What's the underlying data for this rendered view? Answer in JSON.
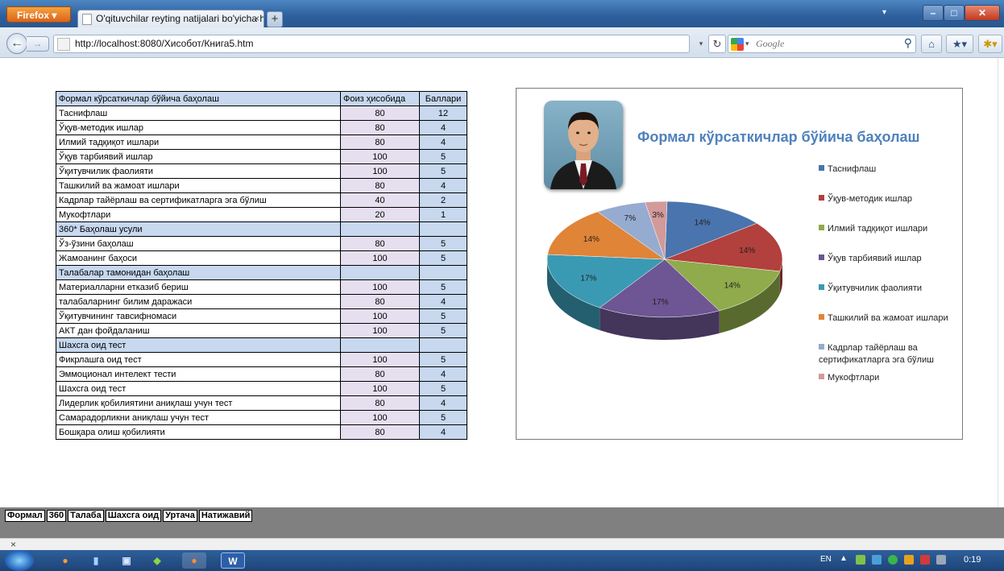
{
  "browser": {
    "menu_button": "Firefox",
    "tab_title": "O'qituvchilar reyting natijalari bo'yicha h...",
    "url": "http://localhost:8080/Хисобот/Книга5.htm",
    "search_placeholder": "Google"
  },
  "table": {
    "header": {
      "criterion": "Формал кўрсаткичлар бўйича баҳолаш",
      "percent": "Фоиз ҳисобида",
      "points": "Баллари"
    },
    "rows": [
      {
        "name": "Таснифлаш",
        "percent": "80",
        "points": "12",
        "section": false
      },
      {
        "name": "Ўқув-методик ишлар",
        "percent": "80",
        "points": "4",
        "section": false
      },
      {
        "name": "Илмий тадқиқот ишлари",
        "percent": "80",
        "points": "4",
        "section": false
      },
      {
        "name": "Ўқув тарбиявий ишлар",
        "percent": "100",
        "points": "5",
        "section": false
      },
      {
        "name": "Ўқитувчилик фаолияти",
        "percent": "100",
        "points": "5",
        "section": false
      },
      {
        "name": "Ташкилий ва жамоат ишлари",
        "percent": "80",
        "points": "4",
        "section": false
      },
      {
        "name": "Кадрлар тайёрлаш ва сертификатларга эга бўлиш",
        "percent": "40",
        "points": "2",
        "section": false
      },
      {
        "name": "Мукофтлари",
        "percent": "20",
        "points": "1",
        "section": false
      },
      {
        "name": "360* Баҳолаш усули",
        "percent": "",
        "points": "",
        "section": true
      },
      {
        "name": "Ўз-ўзини баҳолаш",
        "percent": "80",
        "points": "5",
        "section": false
      },
      {
        "name": "Жамоанинг баҳоси",
        "percent": "100",
        "points": "5",
        "section": false
      },
      {
        "name": "Талабалар тамонидан баҳолаш",
        "percent": "",
        "points": "",
        "section": true
      },
      {
        "name": "Материалларни етказиб бериш",
        "percent": "100",
        "points": "5",
        "section": false
      },
      {
        "name": " талабаларнинг билим даражаси",
        "percent": "80",
        "points": "4",
        "section": false
      },
      {
        "name": "Ўқитувчининг тавсифномаси",
        "percent": "100",
        "points": "5",
        "section": false
      },
      {
        "name": "АКТ дан фойдаланиш",
        "percent": "100",
        "points": "5",
        "section": false
      },
      {
        "name": "Шахсга оид тест",
        "percent": "",
        "points": "",
        "section": true
      },
      {
        "name": "Фикрлашга оид  тест",
        "percent": "100",
        "points": "5",
        "section": false
      },
      {
        "name": "Эммоционал интелект тести",
        "percent": "80",
        "points": "4",
        "section": false
      },
      {
        "name": "Шахсга оид тест",
        "percent": "100",
        "points": "5",
        "section": false
      },
      {
        "name": "Лидерлик қобилиятини аниқлаш учун тест",
        "percent": "80",
        "points": "4",
        "section": false
      },
      {
        "name": "Самарадорликни аниқлаш учун тест",
        "percent": "100",
        "points": "5",
        "section": false
      },
      {
        "name": "Бошқара олиш қобилияти",
        "percent": "80",
        "points": "4",
        "section": false
      }
    ]
  },
  "chart_data": {
    "type": "pie",
    "title": "Формал кўрсаткичлар бўйича баҳолаш",
    "legend_position": "right",
    "categories": [
      "Таснифлаш",
      "Ўқув-методик ишлар",
      "Илмий тадқиқот ишлари",
      "Ўқув тарбиявий ишлар",
      "Ўқитувчилик фаолияти",
      "Ташкилий ва жамоат ишлари",
      "Кадрлар тайёрлаш ва сертификатларга эга бўлиш",
      "Мукофтлари"
    ],
    "values": [
      14,
      14,
      14,
      17,
      17,
      14,
      7,
      3
    ],
    "labels": [
      "14%",
      "14%",
      "14%",
      "17%",
      "17%",
      "14%",
      "7%",
      "3%"
    ],
    "colors": [
      "#4a74ad",
      "#b2403d",
      "#8fab4b",
      "#6e5593",
      "#3a9ab3",
      "#e08438",
      "#95abd0",
      "#d39a9a"
    ]
  },
  "sheet_tabs": [
    "Формал",
    "360",
    "Талаба",
    "Шахсга оид",
    "Уртача",
    "Натижавий"
  ],
  "taskbar": {
    "lang": "EN",
    "clock": "0:19"
  }
}
